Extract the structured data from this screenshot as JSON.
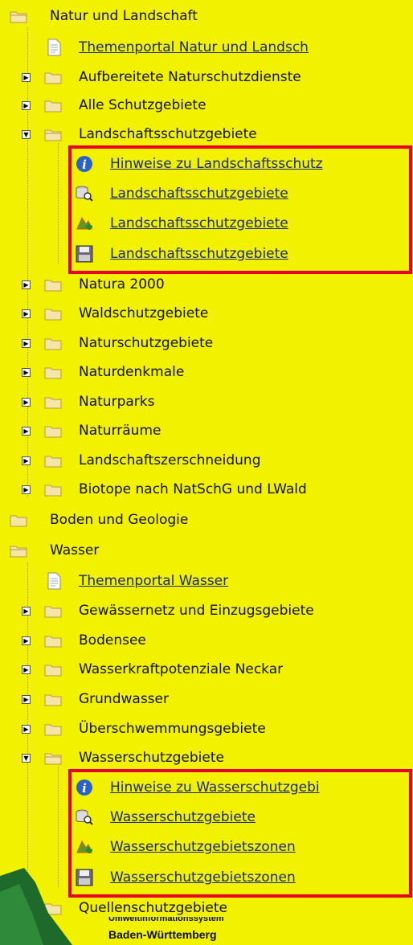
{
  "colors": {
    "background": "#f2f200",
    "highlight": "#e8002a",
    "link": "#1a2a7a"
  },
  "tree": {
    "natur": {
      "label": "Natur und Landschaft",
      "themenportal": "Themenportal Natur und Landsch",
      "aufbereitete": "Aufbereitete Naturschutzdienste",
      "alle": "Alle Schutzgebiete",
      "lsg": {
        "label": "Landschaftsschutzgebiete",
        "hinweise": "Hinweise zu Landschaftsschutz",
        "search": "Landschaftsschutzgebiete",
        "add": "Landschaftsschutzgebiete",
        "download": "Landschaftsschutzgebiete"
      },
      "natura": "Natura 2000",
      "wald": "Waldschutzgebiete",
      "nsg": "Naturschutzgebiete",
      "denkmale": "Naturdenkmale",
      "parks": "Naturparks",
      "raeume": "Naturräume",
      "zerschneidung": "Landschaftszerschneidung",
      "biotope": "Biotope nach NatSchG und LWald"
    },
    "boden": {
      "label": "Boden und Geologie"
    },
    "wasser": {
      "label": "Wasser",
      "themenportal": "Themenportal Wasser",
      "gewaessernetz": "Gewässernetz und Einzugsgebiete",
      "bodensee": "Bodensee",
      "wasserkraft": "Wasserkraftpotenziale Neckar",
      "grundwasser": "Grundwasser",
      "ueberschwemmung": "Überschwemmungsgebiete",
      "wsg": {
        "label": "Wasserschutzgebiete",
        "hinweise": "Hinweise zu Wasserschutzgebi",
        "search": "Wasserschutzgebiete",
        "add": "Wasserschutzgebietszonen",
        "download": "Wasserschutzgebietszonen"
      },
      "quellen": "Quellenschutzgebiete"
    }
  },
  "logo": {
    "line1": "Umweltinformationssystem",
    "line2": "Baden-Württemberg"
  }
}
